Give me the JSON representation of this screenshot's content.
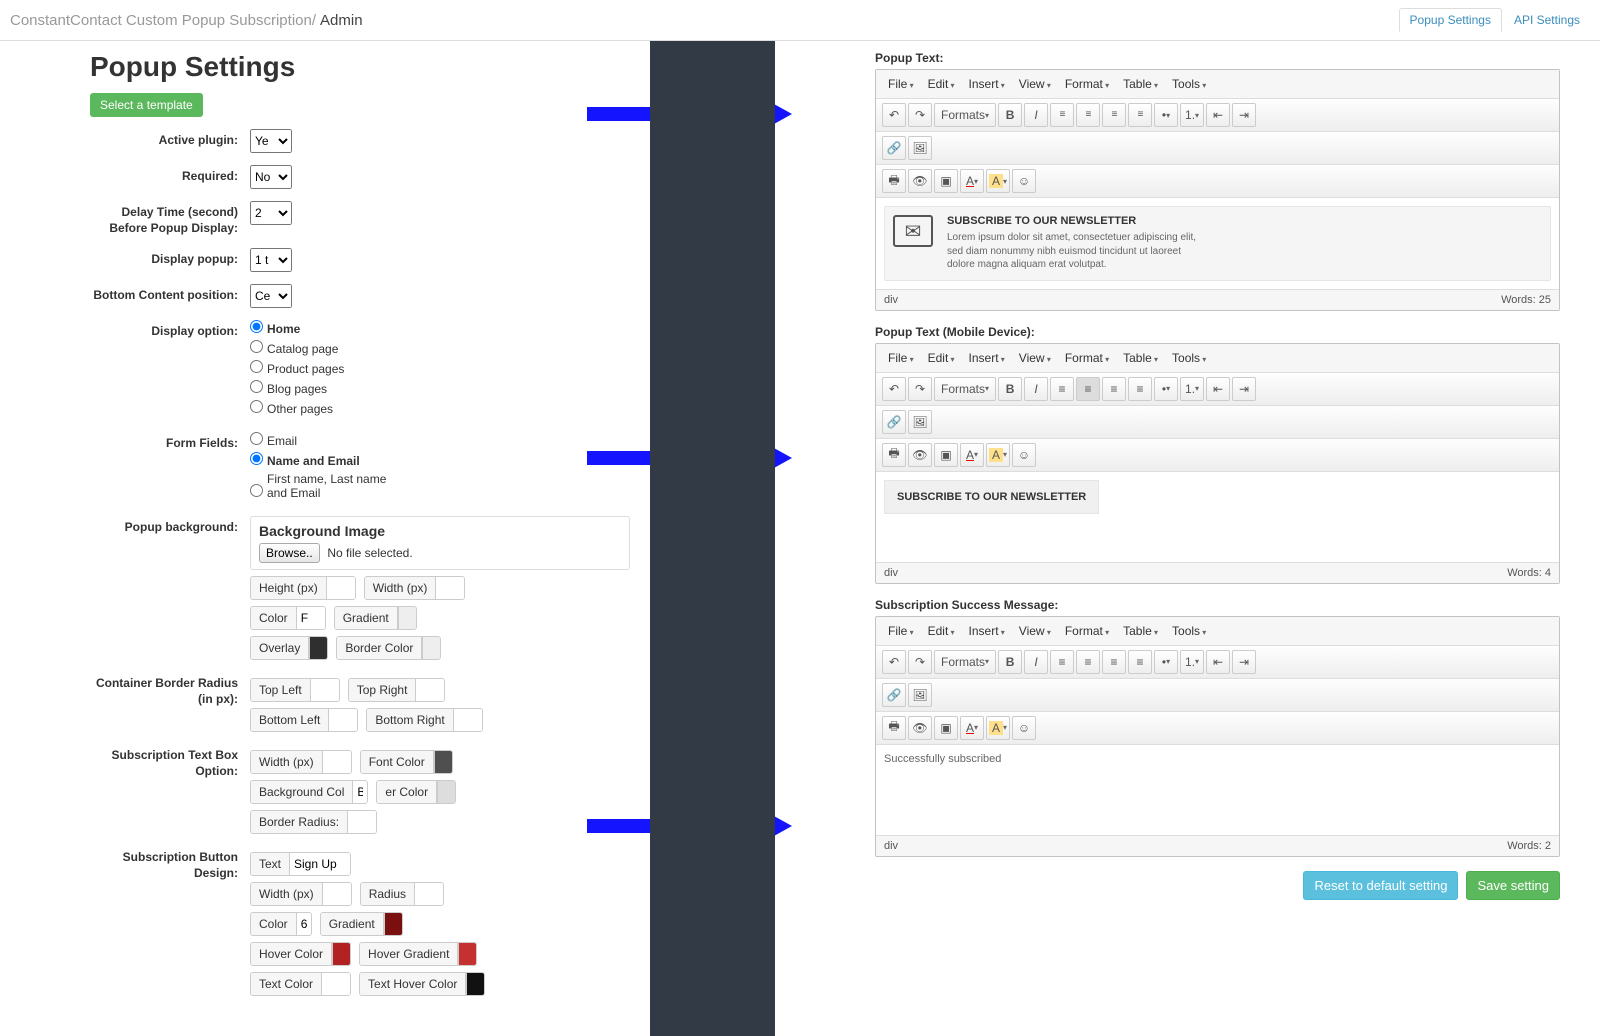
{
  "breadcrumb": {
    "app": "ConstantContact Custom Popup Subscription",
    "sep": " / ",
    "page": "Admin"
  },
  "tabs": {
    "popup": "Popup Settings",
    "api": "API Settings"
  },
  "title": "Popup Settings",
  "select_template": "Select a template",
  "labels": {
    "active": "Active plugin:",
    "required": "Required:",
    "delay": "Delay Time (second) Before Popup Display:",
    "display_popup": "Display popup:",
    "bottom_position": "Bottom Content position:",
    "display_option": "Display option:",
    "form_fields": "Form Fields:",
    "popup_bg": "Popup background:",
    "border_radius": "Container Border Radius (in px):",
    "textbox": "Subscription Text Box Option:",
    "btn_design": "Subscription Button Design:"
  },
  "selects": {
    "active": "Ye",
    "required": "No",
    "delay": "2",
    "display_popup": "1 t",
    "bottom_position": "Ce"
  },
  "display_options": [
    "Home",
    "Catalog page",
    "Product pages",
    "Blog pages",
    "Other pages"
  ],
  "form_fields": [
    "Email",
    "Name and Email",
    "First name, Last name and Email"
  ],
  "bg": {
    "title": "Background Image",
    "browse": "Browse..",
    "nofile": "No file selected.",
    "height": "Height (px)",
    "width": "Width (px)",
    "color": "Color",
    "color_val": "F",
    "gradient": "Gradient",
    "overlay": "Overlay",
    "border_color": "Border Color"
  },
  "radius": {
    "tl": "Top Left",
    "tr": "Top Right",
    "bl": "Bottom Left",
    "br": "Bottom Right"
  },
  "textbox": {
    "width": "Width (px)",
    "font_color": "Font Color",
    "bg_col": "Background Col",
    "bcol": "B",
    "er_color": "er Color",
    "border_radius": "Border Radius:"
  },
  "btn": {
    "text": "Text",
    "text_val": "Sign Up",
    "width": "Width (px)",
    "radius": "Radius",
    "color": "Color",
    "color_val": "6",
    "gradient": "Gradient",
    "hover_color": "Hover Color",
    "hover_gradient": "Hover Gradient",
    "text_color": "Text Color",
    "text_hover": "Text Hover Color"
  },
  "ed_labels": {
    "popup": "Popup Text:",
    "mobile": "Popup Text (Mobile Device):",
    "success": "Subscription Success Message:"
  },
  "menus": [
    "File",
    "Edit",
    "Insert",
    "View",
    "Format",
    "Table",
    "Tools"
  ],
  "formats": "Formats",
  "nl": {
    "title": "SUBSCRIBE TO OUR NEWSLETTER",
    "body": "Lorem ipsum dolor sit amet, consectetuer adipiscing elit, sed diam nonummy nibh euismod tincidunt ut laoreet dolore magna aliquam erat volutpat."
  },
  "mobile_title": "SUBSCRIBE TO OUR NEWSLETTER",
  "success_text": "Successfully subscribed",
  "foot": {
    "status": "div",
    "w25": "Words: 25",
    "w4": "Words: 4",
    "w2": "Words: 2"
  },
  "actions": {
    "reset": "Reset to default setting",
    "save": "Save setting"
  },
  "colors": {
    "overlay": "#2f2f2f",
    "gradient": "#eeeeee",
    "border": "#eeeeee",
    "font": "#4f4f4f",
    "bcol": "#dddddd",
    "btn_grad": "#7a0f0f",
    "hover": "#b22222",
    "hover_grad": "#c53030",
    "text_hover": "#111111"
  }
}
